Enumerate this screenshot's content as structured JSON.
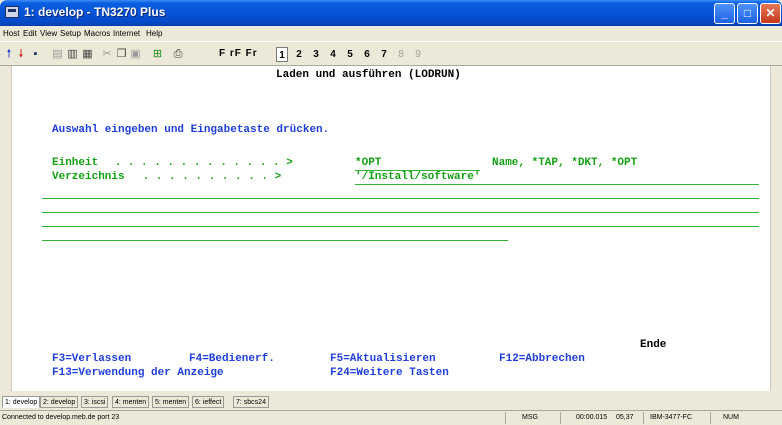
{
  "window": {
    "title": "1: develop - TN3270 Plus"
  },
  "menu": [
    "Host",
    "Edit",
    "View",
    "Setup",
    "Macros",
    "Internet",
    "Help"
  ],
  "toolbar": {
    "fkeys": "F rF Fr",
    "sessions": [
      "1",
      "2",
      "3",
      "4",
      "5",
      "6",
      "7",
      "8",
      "9"
    ],
    "active_session": "1",
    "colors": {
      "up_arrow": "#1a3fd0",
      "down_arrow": "#cc1a1a"
    }
  },
  "screen": {
    "title": "Laden und ausführen (LODRUN)",
    "instruction": "Auswahl eingeben und Eingabetaste drücken.",
    "fields": [
      {
        "label": "Einheit",
        "dots": " . . . . . . . . . . . . . >",
        "value": "*OPT",
        "hint": "Name, *TAP, *DKT, *OPT"
      },
      {
        "label": "Verzeichnis",
        "dots": " . . . . . . . . . . >",
        "value": "'/Install/software'",
        "hint": ""
      }
    ],
    "more": "Ende",
    "fkeys_row1": [
      {
        "text": "F3=Verlassen"
      },
      {
        "text": "F4=Bedienerf."
      },
      {
        "text": "F5=Aktualisieren"
      },
      {
        "text": "F12=Abbrechen"
      }
    ],
    "fkeys_row2": [
      {
        "text": "F13=Verwendung der Anzeige"
      },
      {
        "text": "F24=Weitere Tasten"
      }
    ],
    "colors": {
      "blue": "#1f3fd8",
      "green": "#14a014",
      "black": "#000000"
    }
  },
  "session_tabs": [
    "1: develop",
    "2: develop",
    "3: iscsi",
    "4: menten",
    "5: menten",
    "6: ieffect",
    "7: sbcs24"
  ],
  "status": {
    "connection": "Connected to develop.meb.de port 23",
    "msg": "MSG",
    "timer": "00:00.015",
    "cursor": "05,37",
    "terminal_type": "IBM-3477-FC",
    "num": "NUM"
  }
}
